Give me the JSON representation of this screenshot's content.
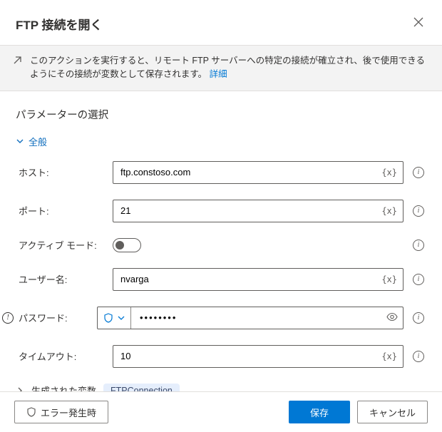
{
  "header": {
    "title": "FTP 接続を開く"
  },
  "banner": {
    "text": "このアクションを実行すると、リモート FTP サーバーへの特定の接続が確立され、後で使用できるようにその接続が変数として保存されます。",
    "link": "詳細"
  },
  "section_title": "パラメーターの選択",
  "groups": {
    "general": {
      "label": "全般"
    },
    "generated": {
      "label": "生成された変数",
      "badge": "FTPConnection"
    }
  },
  "fields": {
    "host": {
      "label": "ホスト:",
      "value": "ftp.constoso.com"
    },
    "port": {
      "label": "ポート:",
      "value": "21"
    },
    "active_mode": {
      "label": "アクティブ モード:",
      "value": false
    },
    "user": {
      "label": "ユーザー名:",
      "value": "nvarga"
    },
    "password": {
      "label": "パスワード:",
      "value": "••••••••"
    },
    "timeout": {
      "label": "タイムアウト:",
      "value": "10"
    }
  },
  "var_marker": "{x}",
  "footer": {
    "on_error": "エラー発生時",
    "save": "保存",
    "cancel": "キャンセル"
  }
}
